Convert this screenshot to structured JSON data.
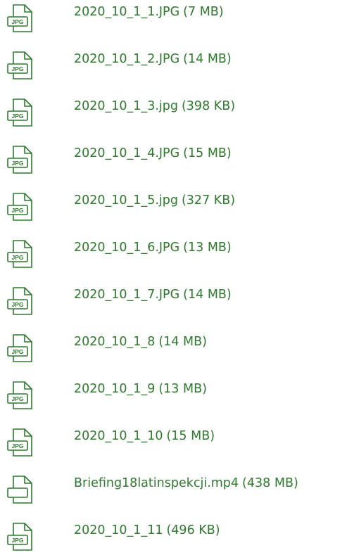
{
  "colors": {
    "link": "#2d7a2d",
    "icon": "#2d7a2d"
  },
  "files": [
    {
      "name": "2020_10_1_1.JPG",
      "size": "(7 MB)",
      "icon": "jpg-file-icon",
      "badge": "JPG"
    },
    {
      "name": "2020_10_1_2.JPG",
      "size": "(14 MB)",
      "icon": "jpg-file-icon",
      "badge": "JPG"
    },
    {
      "name": "2020_10_1_3.jpg",
      "size": "(398 KB)",
      "icon": "jpg-file-icon",
      "badge": "JPG"
    },
    {
      "name": "2020_10_1_4.JPG",
      "size": "(15 MB)",
      "icon": "jpg-file-icon",
      "badge": "JPG"
    },
    {
      "name": "2020_10_1_5.jpg",
      "size": "(327 KB)",
      "icon": "jpg-file-icon",
      "badge": "JPG"
    },
    {
      "name": "2020_10_1_6.JPG",
      "size": "(13 MB)",
      "icon": "jpg-file-icon",
      "badge": "JPG"
    },
    {
      "name": "2020_10_1_7.JPG",
      "size": "(14 MB)",
      "icon": "jpg-file-icon",
      "badge": "JPG"
    },
    {
      "name": "2020_10_1_8",
      "size": "(14 MB)",
      "icon": "jpg-file-icon",
      "badge": "JPG"
    },
    {
      "name": "2020_10_1_9",
      "size": "(13 MB)",
      "icon": "jpg-file-icon",
      "badge": "JPG"
    },
    {
      "name": "2020_10_1_10",
      "size": "(15 MB)",
      "icon": "jpg-file-icon",
      "badge": "JPG"
    },
    {
      "name": "Briefing18latinspekcji.mp4",
      "size": "(438 MB)",
      "icon": "generic-file-icon",
      "badge": ""
    },
    {
      "name": "2020_10_1_11",
      "size": "(496 KB)",
      "icon": "jpg-file-icon",
      "badge": "JPG"
    }
  ]
}
